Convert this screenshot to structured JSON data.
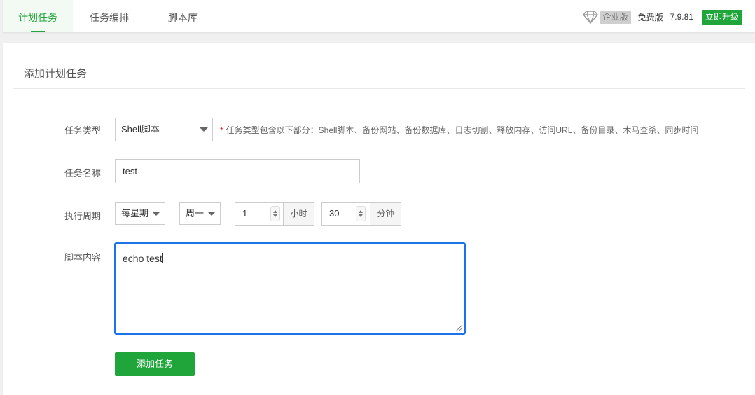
{
  "tabs": [
    {
      "label": "计划任务",
      "active": true
    },
    {
      "label": "任务编排",
      "active": false
    },
    {
      "label": "脚本库",
      "active": false
    }
  ],
  "header": {
    "diamond_icon": "diamond-icon",
    "enterprise_label": "企业版",
    "free_label": "免费版",
    "version": "7.9.81",
    "upgrade_label": "立即升级",
    "accent_color": "#20a53a"
  },
  "form": {
    "title": "添加计划任务",
    "task_type": {
      "label": "任务类型",
      "value": "Shell脚本",
      "hint_star": "*",
      "hint": "任务类型包含以下部分：Shell脚本、备份网站、备份数据库、日志切割、释放内存、访问URL、备份目录、木马查杀、同步时间"
    },
    "task_name": {
      "label": "任务名称",
      "value": "test"
    },
    "cycle": {
      "label": "执行周期",
      "period_value": "每星期",
      "weekday_value": "周一",
      "hour_value": "1",
      "hour_unit": "小时",
      "minute_value": "30",
      "minute_unit": "分钟"
    },
    "script": {
      "label": "脚本内容",
      "value": "echo test"
    },
    "submit_label": "添加任务"
  }
}
